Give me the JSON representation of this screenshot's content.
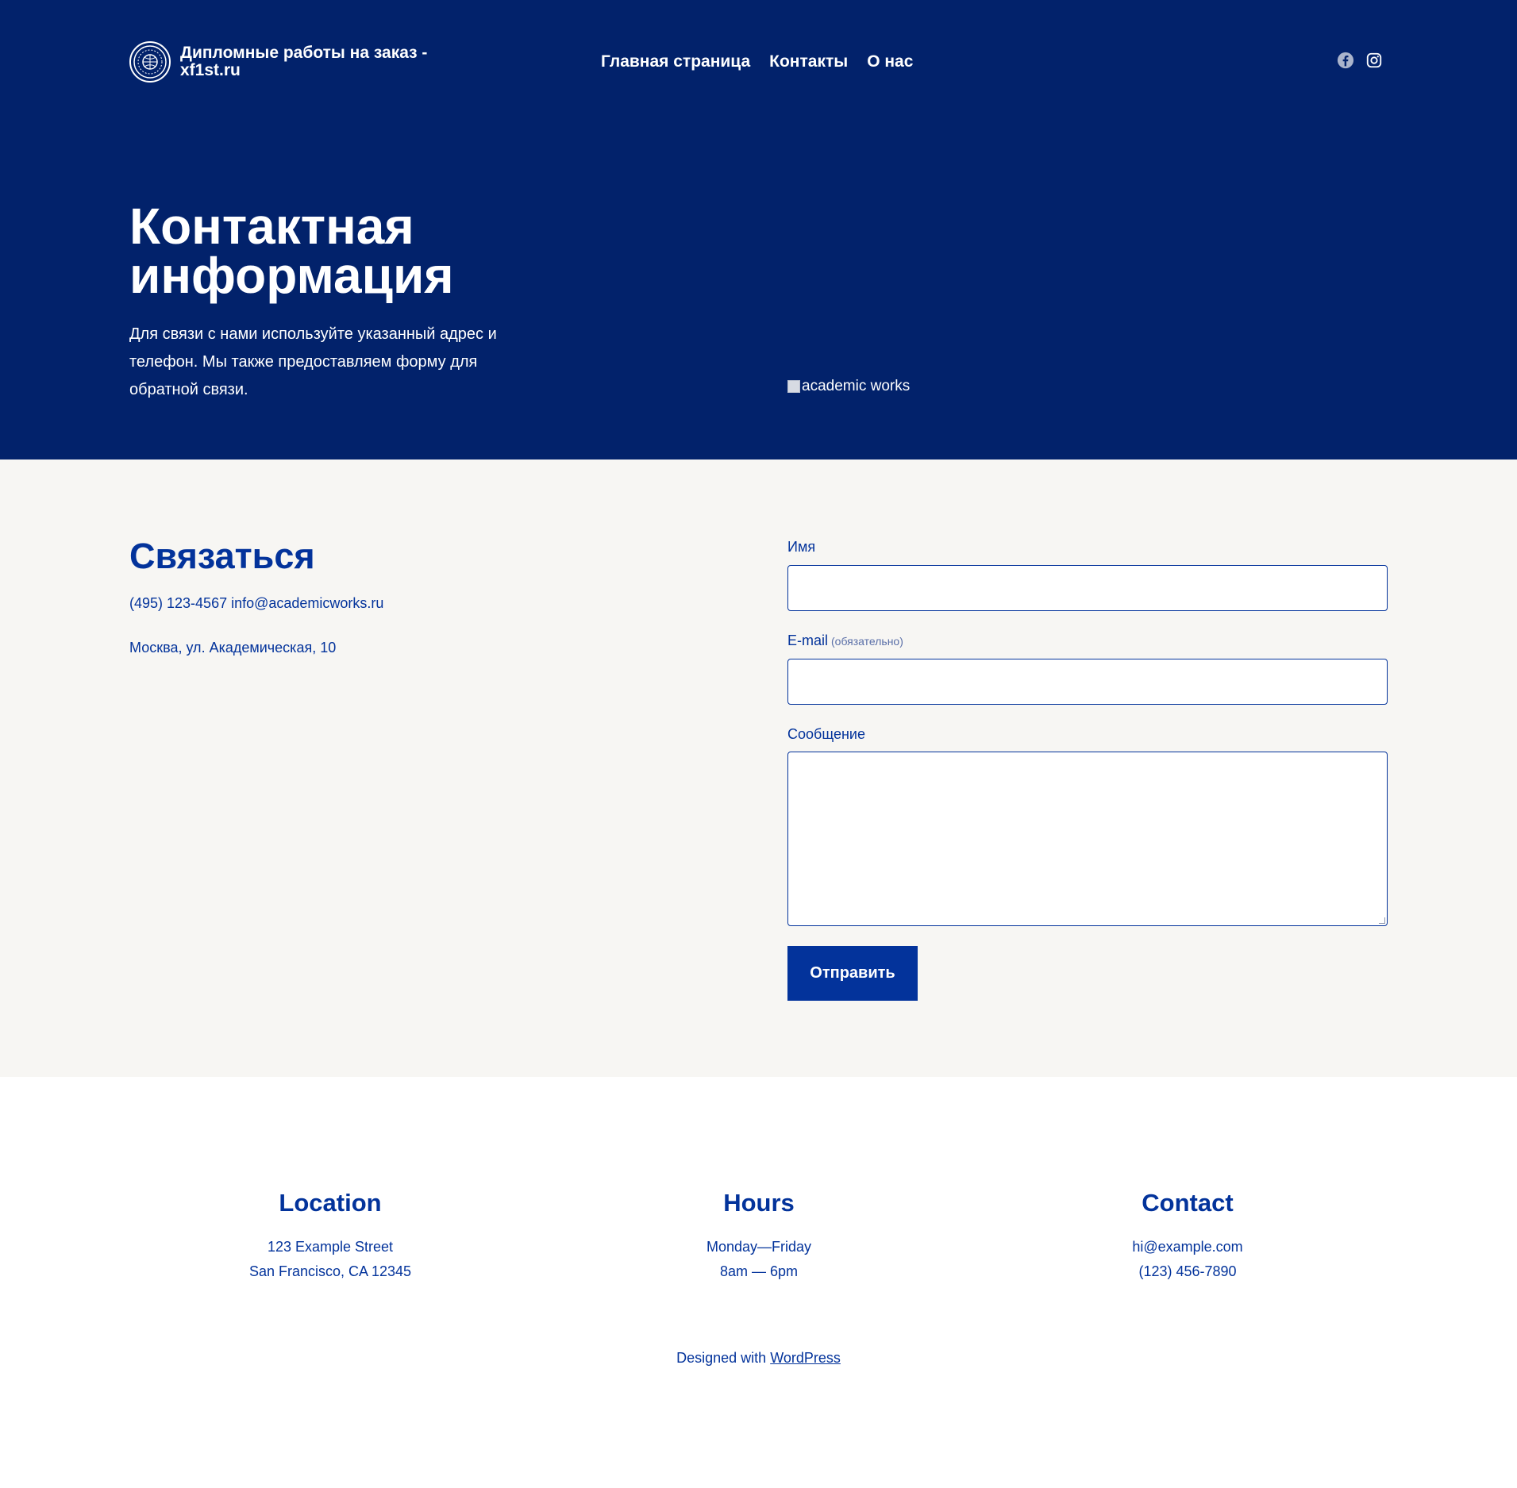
{
  "site": {
    "title": "Дипломные работы на заказ - xf1st.ru",
    "logo_icon": "globe-seal-icon"
  },
  "nav": {
    "items": [
      {
        "label": "Главная страница"
      },
      {
        "label": "Контакты"
      },
      {
        "label": "О нас"
      }
    ]
  },
  "social": {
    "icons": [
      "facebook-icon",
      "instagram-icon"
    ]
  },
  "hero": {
    "title": "Контактная информация",
    "description": "Для связи с нами используйте указанный адрес и телефон. Мы также предоставляем форму для обратной связи.",
    "image_alt": "academic works"
  },
  "contact": {
    "title": "Связаться",
    "phone_email": "(495) 123-4567 info@academicworks.ru",
    "address": "Москва, ул. Академическая, 10"
  },
  "form": {
    "name_label": "Имя",
    "email_label": "E-mail",
    "email_required": "(обязательно)",
    "message_label": "Сообщение",
    "name_value": "",
    "email_value": "",
    "message_value": "",
    "submit_label": "Отправить"
  },
  "footer": {
    "location": {
      "heading": "Location",
      "line1": "123 Example Street",
      "line2": "San Francisco, CA 12345"
    },
    "hours": {
      "heading": "Hours",
      "line1": "Monday—Friday",
      "line2": "8am — 6pm"
    },
    "contact": {
      "heading": "Contact",
      "line1": "hi@example.com",
      "line2": "(123) 456-7890"
    },
    "credit_prefix": "Designed with ",
    "credit_link": "WordPress"
  },
  "colors": {
    "hero_bg": "#02226b",
    "accent": "#03339b",
    "section_bg": "#f7f6f3"
  }
}
